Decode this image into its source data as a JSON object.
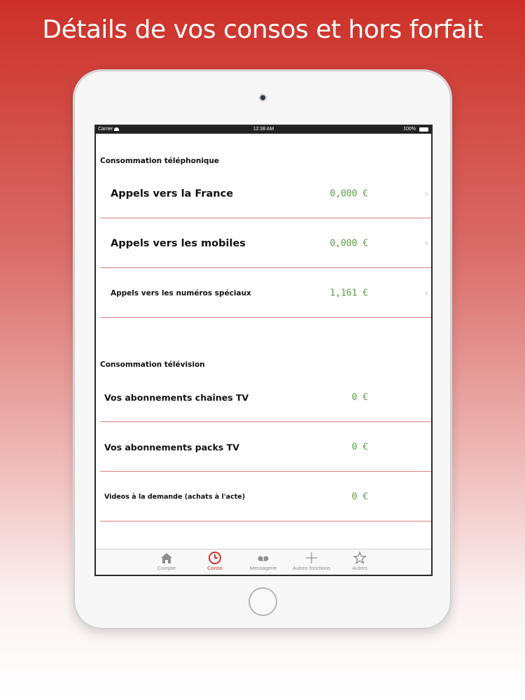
{
  "headline": "Détails de vos consos et hors forfait",
  "status_bar": {
    "carrier": "Carrier",
    "time": "12:38 AM",
    "battery": "100%"
  },
  "sections": {
    "phone": {
      "title": "Consommation téléphonique",
      "rows": [
        {
          "label": "Appels vers la France",
          "value": "0,000 €"
        },
        {
          "label": "Appels vers les mobiles",
          "value": "0,000 €"
        },
        {
          "label": "Appels vers les numéros spéciaux",
          "value": "1,161 €"
        }
      ]
    },
    "tv": {
      "title": "Consommation télévision",
      "rows": [
        {
          "label": "Vos abonnements chaînes TV",
          "value": "0 €"
        },
        {
          "label": "Vos abonnements packs TV",
          "value": "0 €"
        },
        {
          "label": "Videos à la demande (achats à l'acte)",
          "value": "0 €"
        }
      ]
    }
  },
  "chevron": "›",
  "tabs": [
    {
      "label": "Compte",
      "icon": "home-icon"
    },
    {
      "label": "Conso",
      "icon": "clock-icon",
      "active": true
    },
    {
      "label": "Messagerie",
      "icon": "voicemail-icon"
    },
    {
      "label": "Autres fonctions",
      "icon": "plus-icon"
    },
    {
      "label": "Autres",
      "icon": "star-icon"
    }
  ],
  "colors": {
    "accent": "#d0312d",
    "value_green": "#5aa041",
    "separator": "#d98080"
  }
}
